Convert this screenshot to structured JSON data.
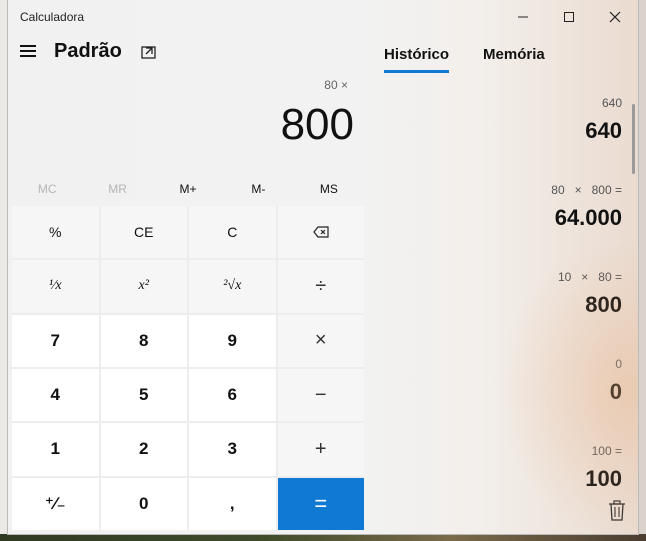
{
  "window": {
    "title": "Calculadora"
  },
  "header": {
    "mode": "Padrão"
  },
  "display": {
    "expression": "80 ×",
    "value": "800"
  },
  "memory": [
    "MC",
    "MR",
    "M+",
    "M-",
    "MS"
  ],
  "keys": {
    "percent": "%",
    "ce": "CE",
    "clear": "C",
    "reciprocal": "¹⁄x",
    "square": "x²",
    "sqrt": "²√x",
    "divide": "÷",
    "multiply": "×",
    "minus": "−",
    "plus": "+",
    "n7": "7",
    "n8": "8",
    "n9": "9",
    "n4": "4",
    "n5": "5",
    "n6": "6",
    "n1": "1",
    "n2": "2",
    "n3": "3",
    "negate": "⁺∕₋",
    "n0": "0",
    "decimal": ",",
    "equals": "="
  },
  "tabs": {
    "history": "Histórico",
    "memory": "Memória"
  },
  "history": [
    {
      "expression": "640",
      "result": "640"
    },
    {
      "expression": "80   ×   800 =",
      "result": "64.000"
    },
    {
      "expression": "10   ×   80 =",
      "result": "800"
    },
    {
      "expression": "0",
      "result": "0"
    },
    {
      "expression": "100 =",
      "result": "100"
    }
  ],
  "colors": {
    "accent": "#0f79d3"
  }
}
